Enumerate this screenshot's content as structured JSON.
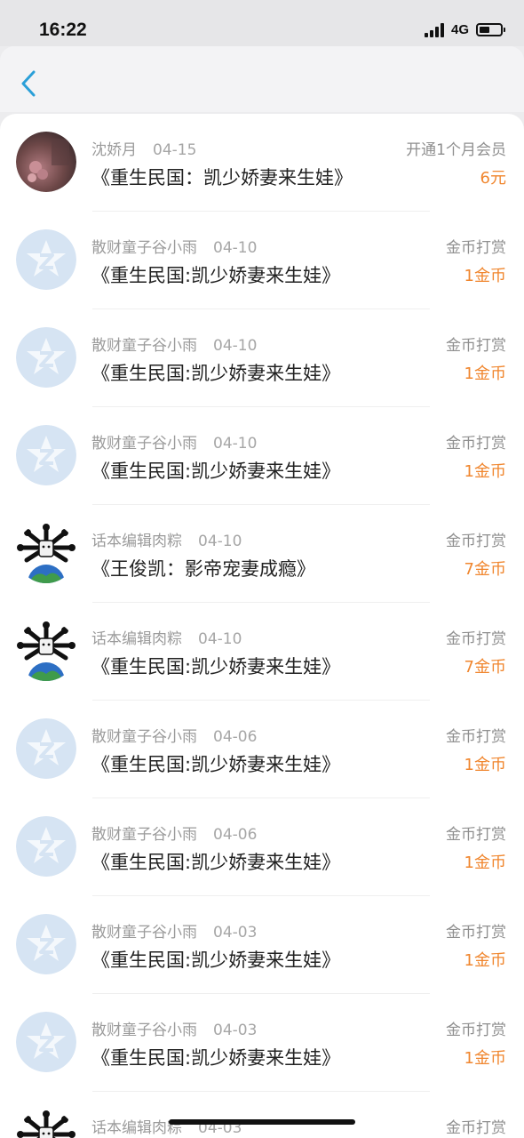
{
  "status_bar": {
    "time": "16:22",
    "network": "4G"
  },
  "colors": {
    "accent": "#2a9fd8",
    "amount": "#f0862e",
    "muted": "#9b9b9b",
    "avatar_default": "#d6e4f3"
  },
  "records": [
    {
      "user": "沈娇月",
      "date": "04-15",
      "title": "《重生民国：凯少娇妻来生娃》",
      "type": "开通1个月会员",
      "amount": "6元",
      "avatar": "photo-avatar"
    },
    {
      "user": "散财童子谷小雨",
      "date": "04-10",
      "title": "《重生民国:凯少娇妻来生娃》",
      "type": "金币打赏",
      "amount": "1金币",
      "avatar": "default-avatar"
    },
    {
      "user": "散财童子谷小雨",
      "date": "04-10",
      "title": "《重生民国:凯少娇妻来生娃》",
      "type": "金币打赏",
      "amount": "1金币",
      "avatar": "default-avatar"
    },
    {
      "user": "散财童子谷小雨",
      "date": "04-10",
      "title": "《重生民国:凯少娇妻来生娃》",
      "type": "金币打赏",
      "amount": "1金币",
      "avatar": "default-avatar"
    },
    {
      "user": "话本编辑肉粽",
      "date": "04-10",
      "title": "《王俊凯：影帝宠妻成瘾》",
      "type": "金币打赏",
      "amount": "7金币",
      "avatar": "cartoon-avatar"
    },
    {
      "user": "话本编辑肉粽",
      "date": "04-10",
      "title": "《重生民国:凯少娇妻来生娃》",
      "type": "金币打赏",
      "amount": "7金币",
      "avatar": "cartoon-avatar"
    },
    {
      "user": "散财童子谷小雨",
      "date": "04-06",
      "title": "《重生民国:凯少娇妻来生娃》",
      "type": "金币打赏",
      "amount": "1金币",
      "avatar": "default-avatar"
    },
    {
      "user": "散财童子谷小雨",
      "date": "04-06",
      "title": "《重生民国:凯少娇妻来生娃》",
      "type": "金币打赏",
      "amount": "1金币",
      "avatar": "default-avatar"
    },
    {
      "user": "散财童子谷小雨",
      "date": "04-03",
      "title": "《重生民国:凯少娇妻来生娃》",
      "type": "金币打赏",
      "amount": "1金币",
      "avatar": "default-avatar"
    },
    {
      "user": "散财童子谷小雨",
      "date": "04-03",
      "title": "《重生民国:凯少娇妻来生娃》",
      "type": "金币打赏",
      "amount": "1金币",
      "avatar": "default-avatar"
    },
    {
      "user": "话本编辑肉粽",
      "date": "04-03",
      "title": "",
      "type": "金币打赏",
      "amount": "",
      "avatar": "cartoon-avatar"
    }
  ]
}
